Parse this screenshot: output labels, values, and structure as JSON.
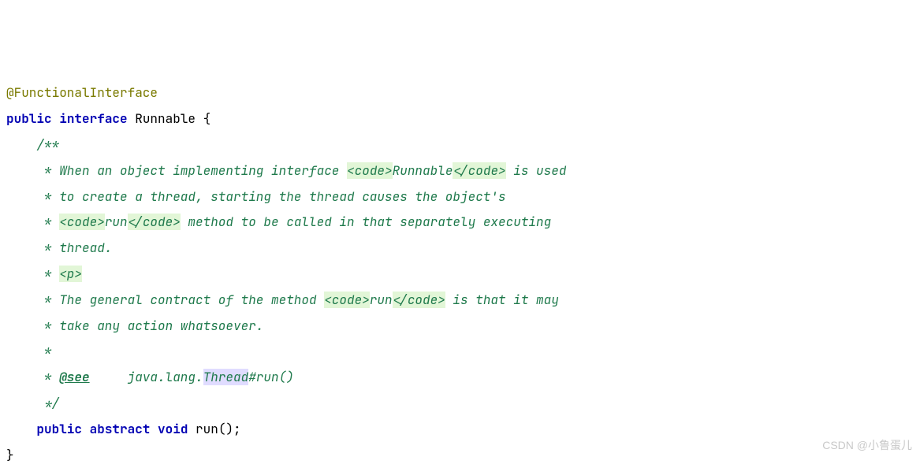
{
  "code": {
    "annotation": "@FunctionalInterface",
    "decl_kw1": "public",
    "decl_kw2": "interface",
    "decl_name": "Runnable",
    "decl_open": " {",
    "javadoc_open": "    /**",
    "line1_a": "     * When an object implementing interface ",
    "line1_tag_open": "<code>",
    "line1_tag_text": "Runnable",
    "line1_tag_close": "</code>",
    "line1_b": " is used",
    "line2": "     * to create a thread, starting the thread causes the object's",
    "line3_a": "     * ",
    "line3_tag_open": "<code>",
    "line3_tag_text": "run",
    "line3_tag_close": "</code>",
    "line3_b": " method to be called in that separately executing",
    "line4": "     * thread.",
    "line5_a": "     * ",
    "line5_tag": "<p>",
    "line6_a": "     * The general contract of the method ",
    "line6_tag_open": "<code>",
    "line6_tag_text": "run",
    "line6_tag_close": "</code>",
    "line6_b": " is that it may",
    "line7": "     * take any action whatsoever.",
    "line8": "     *",
    "line9_a": "     * ",
    "line9_tag": "@see",
    "line9_b": "     java.lang.",
    "line9_hl": "Thread",
    "line9_c": "#run()",
    "javadoc_close": "     */",
    "method_indent": "    ",
    "method_kw1": "public",
    "method_kw2": "abstract",
    "method_kw3": "void",
    "method_name": " run();",
    "close_brace": "}"
  },
  "watermark": "CSDN @小鲁蛋儿"
}
